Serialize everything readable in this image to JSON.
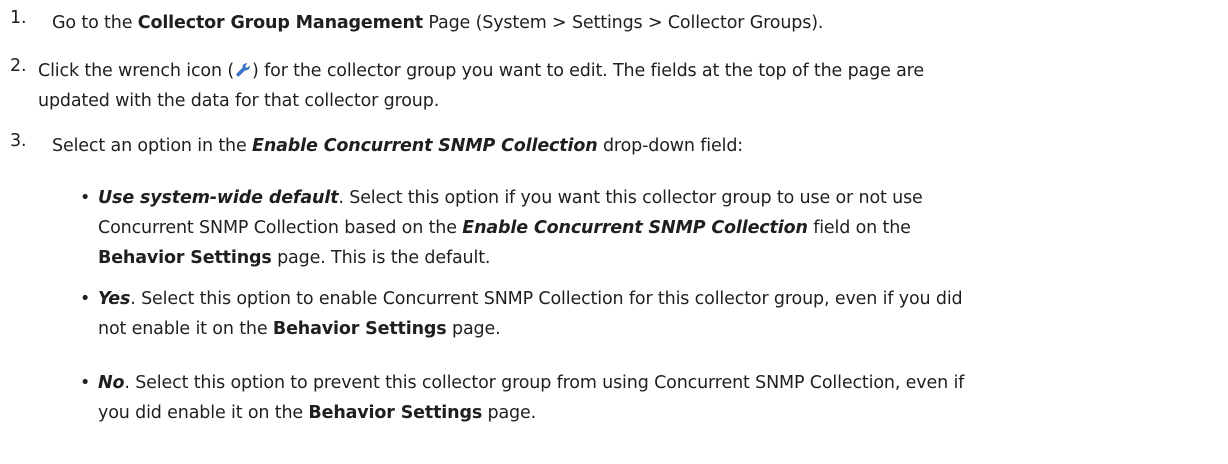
{
  "steps": [
    {
      "number": "1.",
      "parts": {
        "a": "Go to the ",
        "b": "Collector Group Management",
        "c": " Page (System > Settings > Collector Groups)."
      }
    },
    {
      "number": "2.",
      "parts": {
        "a": "Click the wrench icon (",
        "b": ") for the collector group you want to edit. The fields at the top of the page are",
        "c": "updated with the data for that collector group."
      }
    },
    {
      "number": "3.",
      "parts": {
        "a": "Select an option in the ",
        "b": "Enable Concurrent SNMP Collection",
        "c": " drop-down field:"
      }
    }
  ],
  "options": [
    {
      "bullet": "•",
      "name": "Use system-wide default",
      "l1": ". Select this option if you want this collector group to use or not use",
      "l2a": "Concurrent SNMP Collection based on the ",
      "l2b": "Enable Concurrent SNMP Collection",
      "l2c": " field on the",
      "l3a": "Behavior Settings",
      "l3b": " page. This is the default."
    },
    {
      "bullet": "•",
      "name": "Yes",
      "l1": ". Select this option to enable Concurrent SNMP Collection for this collector group, even if you did",
      "l2a": "not enable it on the ",
      "l2b": "Behavior Settings",
      "l2c": " page."
    },
    {
      "bullet": "•",
      "name": "No",
      "l1": ". Select this option to prevent this collector group from using Concurrent SNMP Collection, even if",
      "l2a": "you did enable it on the ",
      "l2b": "Behavior Settings",
      "l2c": " page."
    }
  ],
  "icons": {
    "wrench": "wrench-icon"
  },
  "colors": {
    "wrench_blue": "#3a7bd5"
  }
}
